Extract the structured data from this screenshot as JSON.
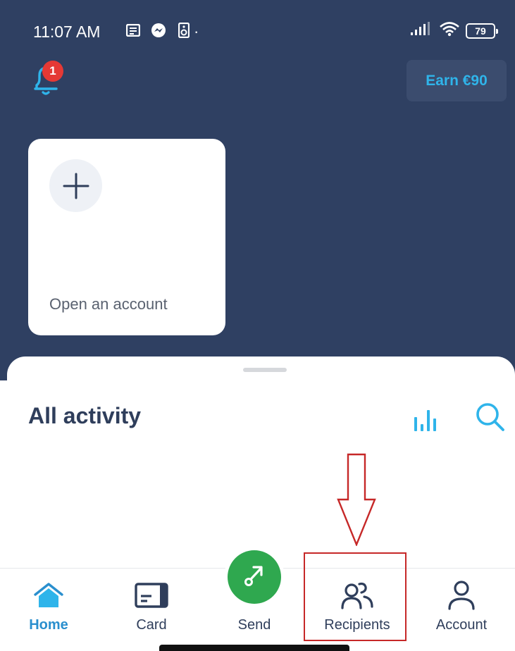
{
  "status_bar": {
    "time": "11:07 AM",
    "dot": "·",
    "battery": "79",
    "icons": [
      "notes-icon",
      "messenger-icon",
      "speaker-icon",
      "signal-icon",
      "wifi-icon",
      "battery-icon"
    ]
  },
  "header": {
    "notification_count": "1",
    "earn_label": "Earn €90"
  },
  "account_card": {
    "label": "Open an account",
    "icon": "plus-icon"
  },
  "activity": {
    "title": "All activity",
    "icons": [
      "stats-icon",
      "search-icon"
    ]
  },
  "nav": {
    "items": [
      {
        "label": "Home",
        "icon": "home-icon",
        "active": true
      },
      {
        "label": "Card",
        "icon": "card-icon",
        "active": false
      },
      {
        "label": "Send",
        "icon": "send-arrow-icon",
        "active": false
      },
      {
        "label": "Recipients",
        "icon": "recipients-icon",
        "active": false
      },
      {
        "label": "Account",
        "icon": "person-icon",
        "active": false
      }
    ]
  },
  "colors": {
    "header_bg": "#2f4062",
    "accent_blue": "#2fb4ea",
    "send_green": "#2fa84f",
    "badge_red": "#e53935",
    "annotation_red": "#c62828"
  }
}
